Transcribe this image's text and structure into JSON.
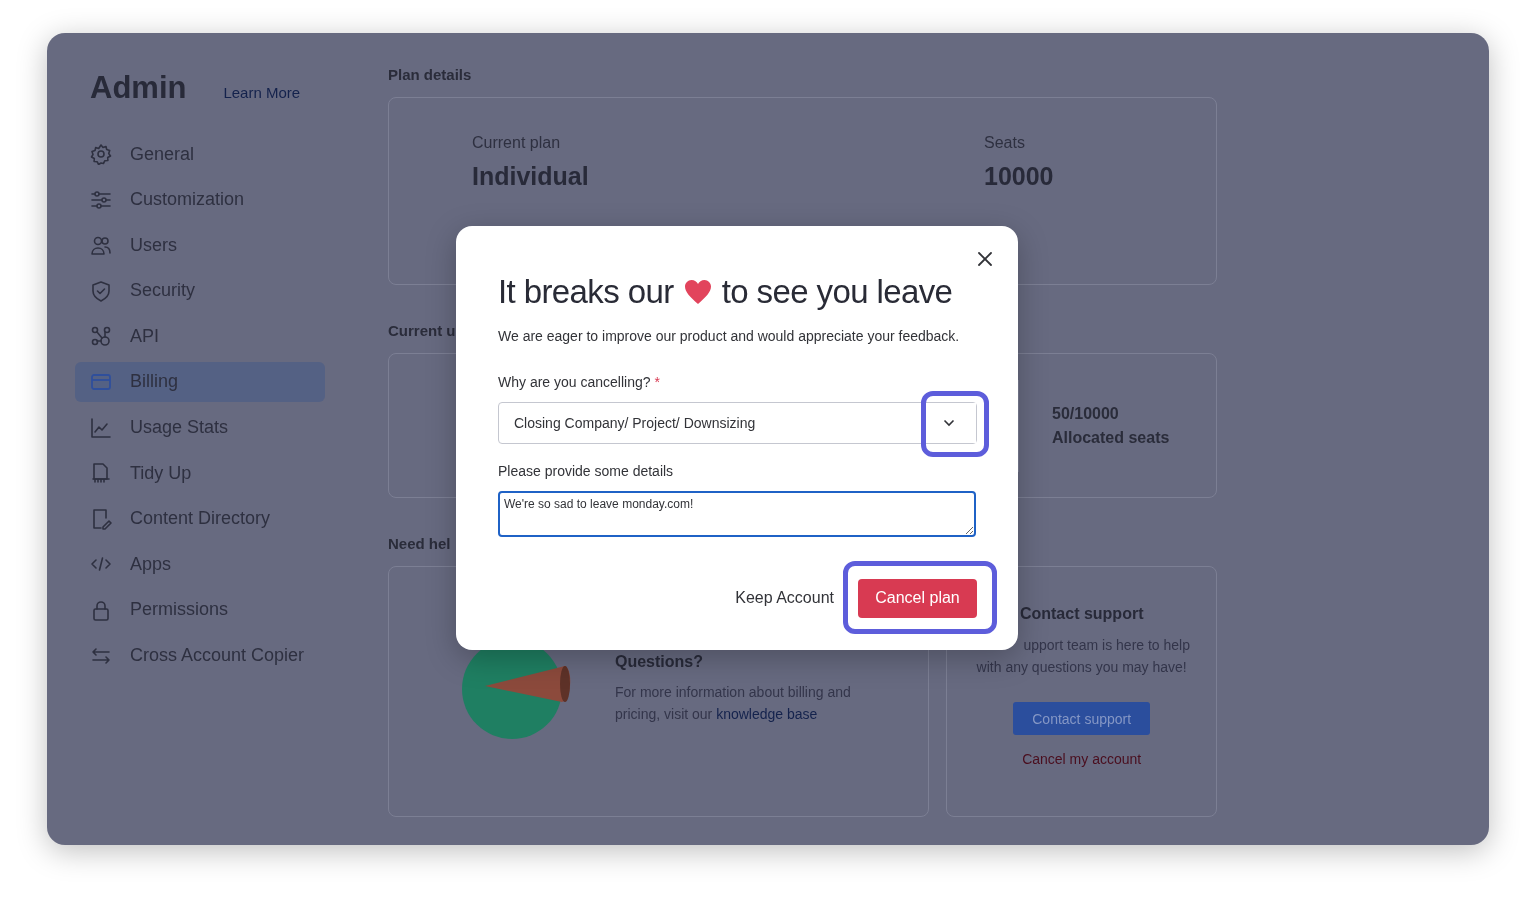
{
  "sidebar": {
    "title": "Admin",
    "learn_more": "Learn More",
    "items": [
      {
        "label": "General",
        "selected": false
      },
      {
        "label": "Customization",
        "selected": false
      },
      {
        "label": "Users",
        "selected": false
      },
      {
        "label": "Security",
        "selected": false
      },
      {
        "label": "API",
        "selected": false
      },
      {
        "label": "Billing",
        "selected": true
      },
      {
        "label": "Usage Stats",
        "selected": false
      },
      {
        "label": "Tidy Up",
        "selected": false
      },
      {
        "label": "Content Directory",
        "selected": false
      },
      {
        "label": "Apps",
        "selected": false
      },
      {
        "label": "Permissions",
        "selected": false
      },
      {
        "label": "Cross Account Copier",
        "selected": false
      }
    ]
  },
  "plan_details": {
    "heading": "Plan details",
    "current_plan_label": "Current plan",
    "current_plan": "Individual",
    "seats_label": "Seats",
    "seats": "10000"
  },
  "current_usage": {
    "heading": "Current u",
    "seats_count": "50/10000",
    "seats_label": "Allocated seats"
  },
  "need_help": {
    "heading": "Need hel",
    "questions": {
      "title": "Questions?",
      "text": "For more information about billing and pricing, visit our ",
      "link": "knowledge base"
    },
    "contact": {
      "title": "Contact support",
      "lines": [
        "upport team is here to help",
        "with any questions you may have!"
      ],
      "button": "Contact support",
      "cancel_link": "Cancel my account"
    }
  },
  "modal": {
    "title_start": "It breaks our",
    "title_end": "to see you leave",
    "subtitle": "We are eager to improve our product and would appreciate your feedback.",
    "reason": {
      "label": "Why are you cancelling?",
      "required_mark": "*",
      "value": "Closing Company/ Project/ Downsizing",
      "highlighted": true
    },
    "details": {
      "label": "Please provide some details",
      "value": "We're so sad to leave monday.com!"
    },
    "keep_button": {
      "label": "Keep Account"
    },
    "cancel_button": {
      "label": "Cancel plan",
      "highlighted": true
    }
  }
}
